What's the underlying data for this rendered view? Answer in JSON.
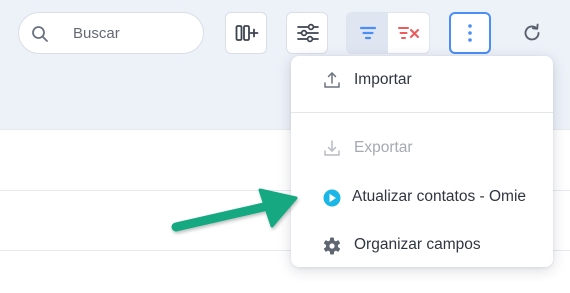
{
  "search": {
    "placeholder": "Buscar"
  },
  "toolbar": {
    "columns_icon": "add-column-icon",
    "filters_icon": "sliders-icon",
    "filter_icon": "filter-icon",
    "clear_filter_icon": "clear-filter-icon",
    "more_icon": "vertical-dots-icon",
    "refresh_icon": "refresh-icon"
  },
  "menu": {
    "items": [
      {
        "label": "Importar",
        "icon": "upload-icon",
        "enabled": true
      },
      {
        "label": "Exportar",
        "icon": "download-icon",
        "enabled": false
      },
      {
        "label": "Atualizar contatos - Omie",
        "icon": "omie-play-icon",
        "enabled": true
      },
      {
        "label": "Organizar campos",
        "icon": "gear-icon",
        "enabled": true
      }
    ]
  },
  "colors": {
    "accent_blue": "#4a8ef7",
    "clear_filter_red": "#ef5a5a",
    "omie_cyan": "#19b6e6",
    "annotation_arrow": "#13a880",
    "toolbar_background": "#edf1f8"
  }
}
